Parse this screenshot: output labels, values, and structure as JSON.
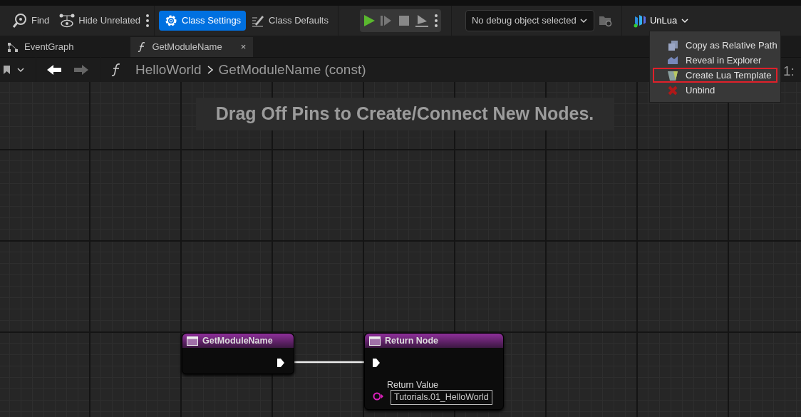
{
  "toolbar": {
    "buttons": [
      {
        "kind": "find",
        "label": "Find",
        "selected": false
      },
      {
        "kind": "hide",
        "label": "Hide Unrelated",
        "selected": false
      },
      {
        "kind": "more"
      },
      {
        "kind": "settings",
        "label": "Class Settings",
        "selected": true
      },
      {
        "kind": "defaults",
        "label": "Class Defaults",
        "selected": false
      }
    ],
    "debug_selector": {
      "value": "No debug object selected"
    },
    "plugin_menu": {
      "label": "UnLua",
      "expanded": true,
      "items": [
        {
          "label": "Copy as Relative Path",
          "kind": "copy",
          "highlighted": false
        },
        {
          "label": "Reveal in Explorer",
          "kind": "reveal",
          "highlighted": false
        },
        {
          "label": "Create Lua Template",
          "kind": "template",
          "highlighted": true
        },
        {
          "label": "Unbind",
          "kind": "unbind",
          "highlighted": false
        }
      ]
    }
  },
  "tabs": [
    {
      "label": "EventGraph",
      "kind": "graph",
      "selected": false
    },
    {
      "label": "GetModuleName",
      "kind": "function",
      "selected": true,
      "close": "×"
    }
  ],
  "breadcrumb": {
    "back_enabled": true,
    "forward_enabled": false,
    "items": [
      "HelloWorld",
      "GetModuleName (const)"
    ],
    "zoom_label": "1:"
  },
  "canvas": {
    "hint": "Drag Off Pins to Create/Connect New Nodes.",
    "nodes": [
      {
        "title": "GetModuleName",
        "kind": "entry"
      },
      {
        "title": "Return Node",
        "kind": "result",
        "pin_label": "Return Value",
        "pin_value": "Tutorials.01_HelloWorld"
      }
    ]
  }
}
